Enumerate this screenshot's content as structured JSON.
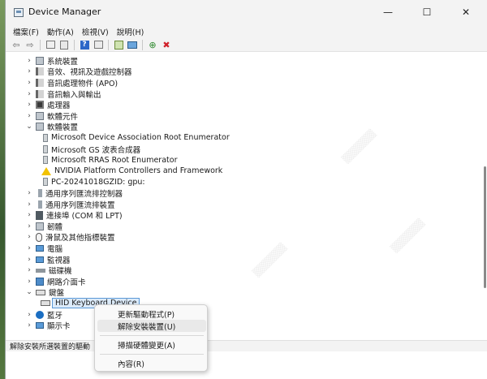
{
  "window": {
    "title": "Device Manager",
    "minimize_glyph": "—",
    "maximize_glyph": "☐",
    "close_glyph": "✕"
  },
  "menubar": [
    {
      "label": "檔案(F)"
    },
    {
      "label": "動作(A)"
    },
    {
      "label": "檢視(V)"
    },
    {
      "label": "說明(H)"
    }
  ],
  "toolbar": {
    "icons": [
      "back-icon",
      "forward-icon",
      "properties-icon",
      "show-hidden-icon",
      "help-icon",
      "details-icon",
      "update-driver-icon",
      "scan-icon",
      "enable-icon",
      "uninstall-icon"
    ],
    "back_glyph": "⇦",
    "forward_glyph": "⇨",
    "help_glyph": "?",
    "enable_glyph": "⊕",
    "uninstall_glyph": "✖",
    "accent_uninstall": "#d0202a",
    "accent_help": "#2d67c8"
  },
  "tree": {
    "expanded_glyph": "⌄",
    "collapsed_glyph": "›",
    "items": [
      {
        "label": "系統裝置",
        "state": "collapsed",
        "icon": "system-icon",
        "indent": 0
      },
      {
        "label": "音效、視訊及遊戲控制器",
        "state": "collapsed",
        "icon": "speaker-icon",
        "indent": 0
      },
      {
        "label": "音訊處理物件 (APO)",
        "state": "collapsed",
        "icon": "speaker-icon",
        "indent": 0
      },
      {
        "label": "音訊輸入與輸出",
        "state": "collapsed",
        "icon": "speaker-icon",
        "indent": 0
      },
      {
        "label": "處理器",
        "state": "collapsed",
        "icon": "processor-icon",
        "indent": 0
      },
      {
        "label": "軟體元件",
        "state": "collapsed",
        "icon": "software-component-icon",
        "indent": 0
      },
      {
        "label": "軟體裝置",
        "state": "expanded",
        "icon": "software-device-icon",
        "indent": 0
      },
      {
        "label": "Microsoft Device Association Root Enumerator",
        "state": "leaf",
        "icon": "device-icon",
        "indent": 1
      },
      {
        "label": "Microsoft GS 波表合成器",
        "state": "leaf",
        "icon": "device-icon",
        "indent": 1
      },
      {
        "label": "Microsoft RRAS Root Enumerator",
        "state": "leaf",
        "icon": "device-icon",
        "indent": 1
      },
      {
        "label": "NVIDIA Platform Controllers and Framework",
        "state": "leaf",
        "icon": "warning-icon",
        "indent": 1
      },
      {
        "label": "PC-20241018GZID: gpu:",
        "state": "leaf",
        "icon": "device-icon",
        "indent": 1
      },
      {
        "label": "通用序列匯流排控制器",
        "state": "collapsed",
        "icon": "usb-icon",
        "indent": 0
      },
      {
        "label": "通用序列匯流排裝置",
        "state": "collapsed",
        "icon": "usb-icon",
        "indent": 0
      },
      {
        "label": "連接埠 (COM 和 LPT)",
        "state": "collapsed",
        "icon": "port-icon",
        "indent": 0
      },
      {
        "label": "韌體",
        "state": "collapsed",
        "icon": "firmware-icon",
        "indent": 0
      },
      {
        "label": "滑鼠及其他指標裝置",
        "state": "collapsed",
        "icon": "mouse-icon",
        "indent": 0
      },
      {
        "label": "電腦",
        "state": "collapsed",
        "icon": "computer-icon",
        "indent": 0
      },
      {
        "label": "監視器",
        "state": "collapsed",
        "icon": "monitor-icon",
        "indent": 0
      },
      {
        "label": "磁碟機",
        "state": "collapsed",
        "icon": "disk-icon",
        "indent": 0
      },
      {
        "label": "網路介面卡",
        "state": "collapsed",
        "icon": "network-icon",
        "indent": 0
      },
      {
        "label": "鍵盤",
        "state": "expanded",
        "icon": "keyboard-icon",
        "indent": 0
      },
      {
        "label": "HID Keyboard Device",
        "state": "leaf",
        "icon": "keyboard-icon",
        "indent": 1,
        "selected": true
      },
      {
        "label": "藍牙",
        "state": "collapsed",
        "icon": "bluetooth-icon",
        "indent": 0
      },
      {
        "label": "顯示卡",
        "state": "collapsed",
        "icon": "display-adapter-icon",
        "indent": 0
      }
    ]
  },
  "status": {
    "text": "解除安裝所選裝置的驅動"
  },
  "context_menu": {
    "items": [
      {
        "label": "更新驅動程式(P)"
      },
      {
        "label": "解除安裝裝置(U)",
        "hover": true
      },
      {
        "label": "掃描硬體變更(A)"
      },
      {
        "label": "內容(R)"
      }
    ]
  }
}
